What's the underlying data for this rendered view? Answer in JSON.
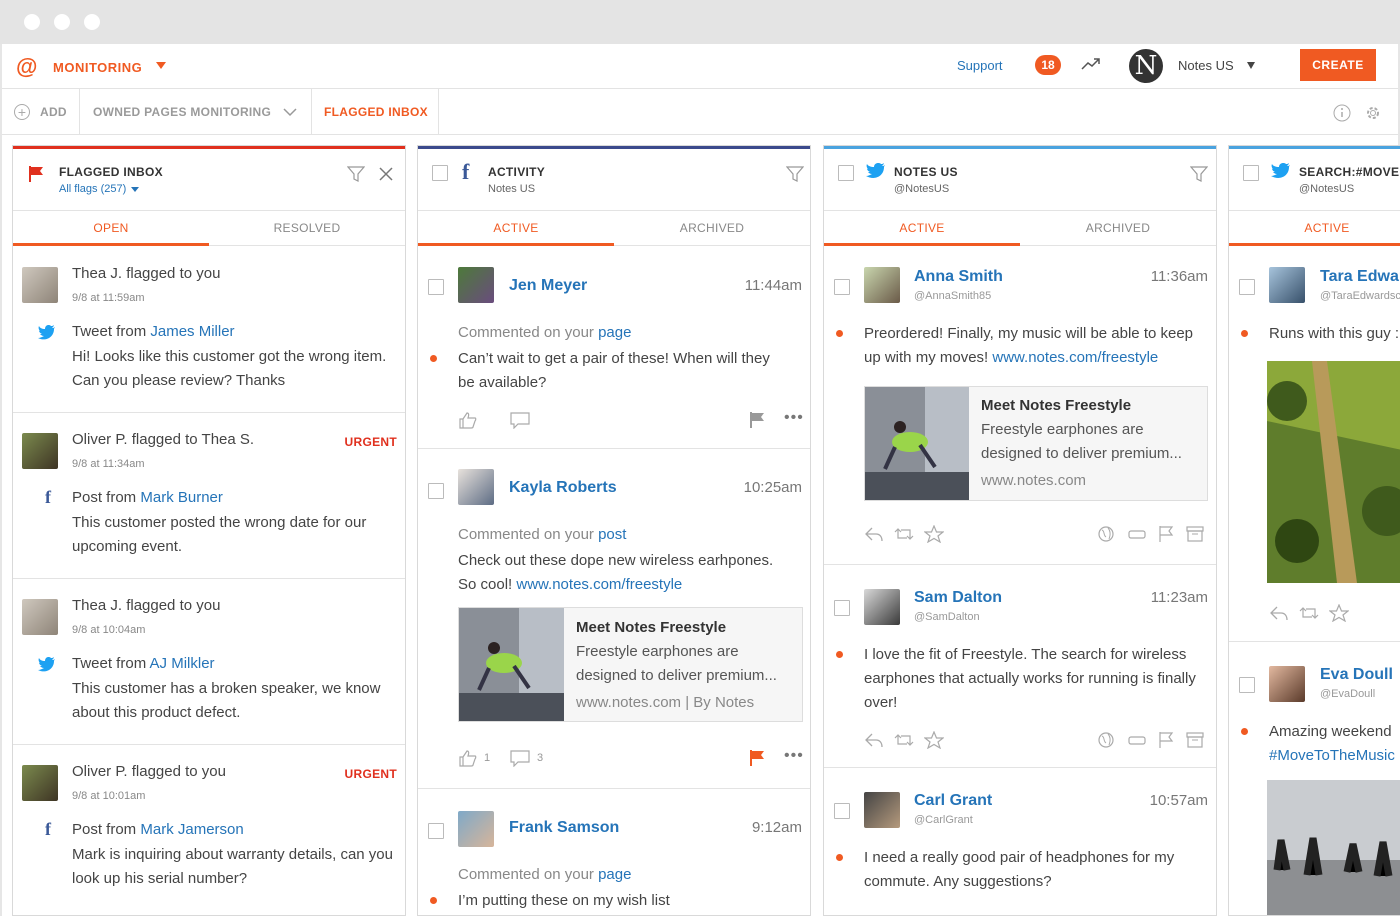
{
  "header": {
    "app_icon": "@",
    "section": "MONITORING",
    "support": "Support",
    "notifications": "18",
    "account": "Notes US",
    "account_initial": "N",
    "create": "CREATE"
  },
  "tabbar": {
    "add": "ADD",
    "owned": "OWNED PAGES MONITORING",
    "flagged": "FLAGGED INBOX"
  },
  "col1": {
    "title": "FLAGGED INBOX",
    "filter": "All flags (257)",
    "tabs": [
      "OPEN",
      "RESOLVED"
    ],
    "items": [
      {
        "flagged": "Thea J. flagged to you",
        "date": "9/8 at 11:59am",
        "source_prefix": "Tweet from ",
        "source_name": "James Miller",
        "body": "Hi! Looks like this customer got the wrong item. Can you please review? Thanks",
        "urgent": ""
      },
      {
        "flagged": "Oliver P. flagged to Thea S.",
        "date": "9/8 at 11:34am",
        "source_prefix": "Post from ",
        "source_name": "Mark Burner",
        "body": "This customer posted the wrong date for our upcoming event.",
        "urgent": "URGENT"
      },
      {
        "flagged": "Thea J. flagged to you",
        "date": "9/8 at 10:04am",
        "source_prefix": "Tweet from ",
        "source_name": "AJ Milkler",
        "body": "This customer has a broken speaker, we know about this product defect.",
        "urgent": ""
      },
      {
        "flagged": "Oliver P. flagged to you",
        "date": "9/8 at 10:01am",
        "source_prefix": "Post from ",
        "source_name": "Mark Jamerson",
        "body": "Mark is inquiring about warranty details, can you look up his serial number?",
        "urgent": "URGENT"
      }
    ]
  },
  "col2": {
    "title": "ACTIVITY",
    "subtitle": "Notes US",
    "tabs": [
      "ACTIVE",
      "ARCHIVED"
    ],
    "items": [
      {
        "name": "Jen Meyer",
        "time": "11:44am",
        "commented": "Commented on your ",
        "target": "page",
        "body": "Can’t wait to get a pair of these! When will they be available?"
      },
      {
        "name": "Kayla Roberts",
        "time": "10:25am",
        "commented": "Commented on your ",
        "target": "post",
        "body": "Check out these dope new wireless earhpones. So cool! ",
        "link": "www.notes.com/freestyle",
        "likes": "1",
        "comments": "3"
      },
      {
        "name": "Frank Samson",
        "time": "9:12am",
        "commented": "Commented on your ",
        "target": "page",
        "body": "I’m putting these on my wish list"
      }
    ],
    "card": {
      "title": "Meet Notes Freestyle",
      "desc": "Freestyle earphones are designed to deliver premium...",
      "url": "www.notes.com | By Notes"
    }
  },
  "col3": {
    "title": "NOTES US",
    "subtitle": "@NotesUS",
    "tabs": [
      "ACTIVE",
      "ARCHIVED"
    ],
    "items": [
      {
        "name": "Anna Smith",
        "handle": "@AnnaSmith85",
        "time": "11:36am",
        "body": "Preordered! Finally, my music will be able to keep up with my moves!  ",
        "link": "www.notes.com/freestyle"
      },
      {
        "name": "Sam Dalton",
        "handle": "@SamDalton",
        "time": "11:23am",
        "body": "I love the fit of Freestyle. The search for wireless earphones that actually works for running is finally over!"
      },
      {
        "name": "Carl Grant",
        "handle": "@CarlGrant",
        "time": "10:57am",
        "body": "I need a really good pair of headphones for my commute. Any suggestions?"
      }
    ],
    "card": {
      "title": "Meet Notes Freestyle",
      "desc": "Freestyle earphones are designed to deliver premium...",
      "url": "www.notes.com"
    }
  },
  "col4": {
    "title": "SEARCH:#MOVE",
    "subtitle": "@NotesUS",
    "tabs": [
      "ACTIVE"
    ],
    "items": [
      {
        "name": "Tara Edwar",
        "handle": "@TaraEdwardsc",
        "body": "Runs with this guy :"
      },
      {
        "name": "Eva Doull",
        "handle": "@EvaDoull",
        "body": "Amazing weekend",
        "hashtag": "#MoveToTheMusic"
      }
    ]
  },
  "colors": {
    "accent": "#f05a22",
    "link": "#2574b8",
    "twitter": "#1da1f2",
    "facebook": "#3b5998"
  }
}
